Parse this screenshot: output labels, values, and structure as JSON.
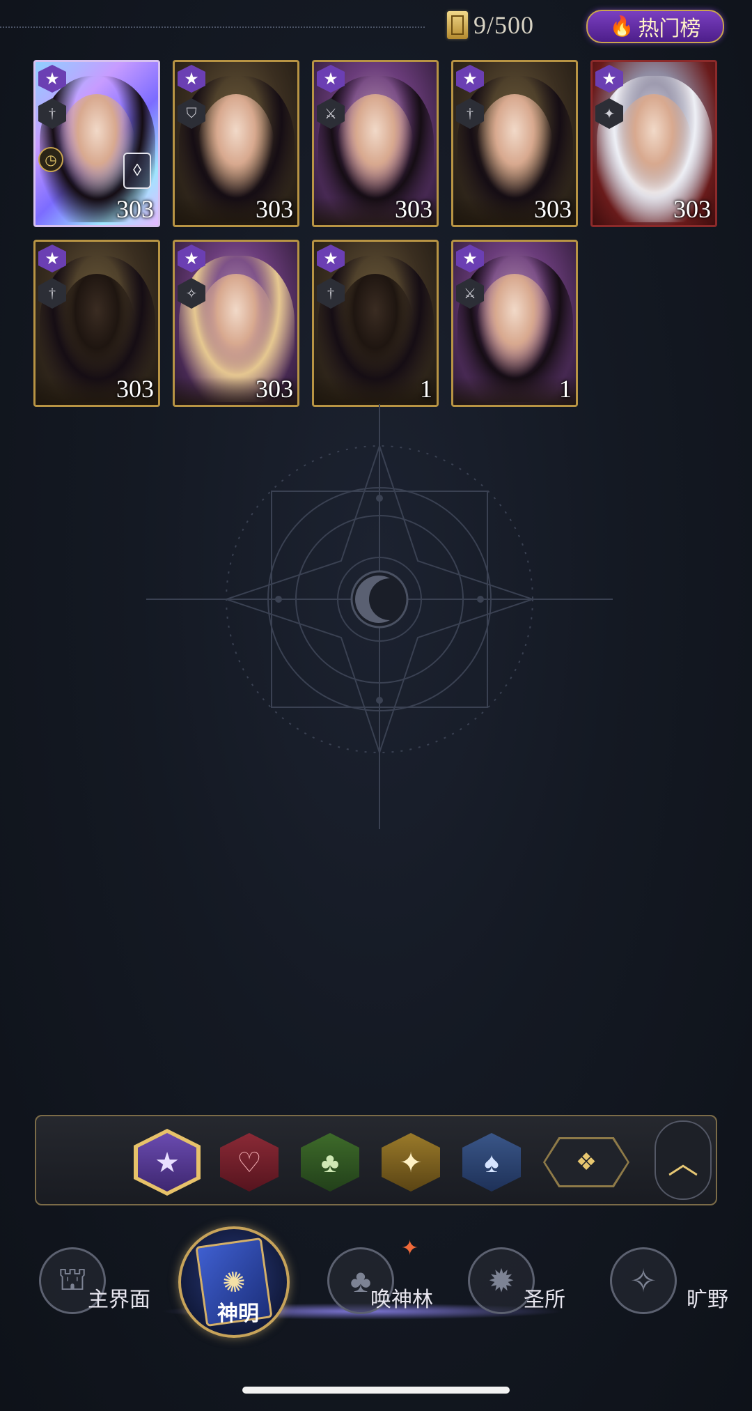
{
  "header": {
    "capacity_text": "9/500",
    "hot_button_label": "热门榜"
  },
  "cards": [
    {
      "level": "303"
    },
    {
      "level": "303"
    },
    {
      "level": "303"
    },
    {
      "level": "303"
    },
    {
      "level": "303"
    },
    {
      "level": "303"
    },
    {
      "level": "303"
    },
    {
      "level": "1"
    },
    {
      "level": "1"
    }
  ],
  "filters": [
    "star",
    "heart",
    "club",
    "diamond",
    "spade",
    "all"
  ],
  "nav": {
    "items": [
      {
        "label": "主界面"
      },
      {
        "label": "神明"
      },
      {
        "label": "唤神林"
      },
      {
        "label": "圣所"
      },
      {
        "label": "旷野"
      }
    ]
  }
}
